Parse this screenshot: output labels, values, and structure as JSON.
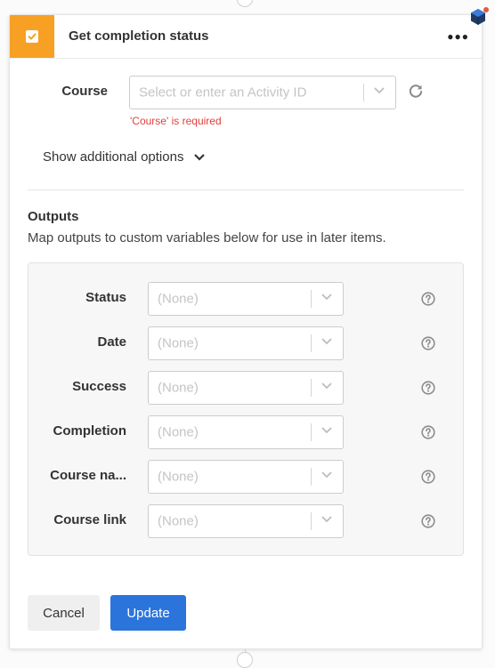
{
  "header": {
    "title": "Get completion status"
  },
  "course": {
    "label": "Course",
    "placeholder": "Select or enter an Activity ID",
    "error": "'Course' is required"
  },
  "show_more": "Show additional options",
  "outputs": {
    "title": "Outputs",
    "description": "Map outputs to custom variables below for use in later items.",
    "rows": [
      {
        "label": "Status",
        "value": "(None)"
      },
      {
        "label": "Date",
        "value": "(None)"
      },
      {
        "label": "Success",
        "value": "(None)"
      },
      {
        "label": "Completion",
        "value": "(None)"
      },
      {
        "label": "Course na...",
        "value": "(None)"
      },
      {
        "label": "Course link",
        "value": "(None)"
      }
    ]
  },
  "buttons": {
    "cancel": "Cancel",
    "update": "Update"
  },
  "colors": {
    "accent": "#f7a024",
    "primary": "#2b74db",
    "error": "#e0403d"
  },
  "icons": {
    "header": "checkbox-icon",
    "more": "more-options-icon",
    "dropdown": "chevron-down-icon",
    "refresh": "refresh-icon",
    "help": "help-circle-icon",
    "badge": "cube-badge-icon"
  }
}
